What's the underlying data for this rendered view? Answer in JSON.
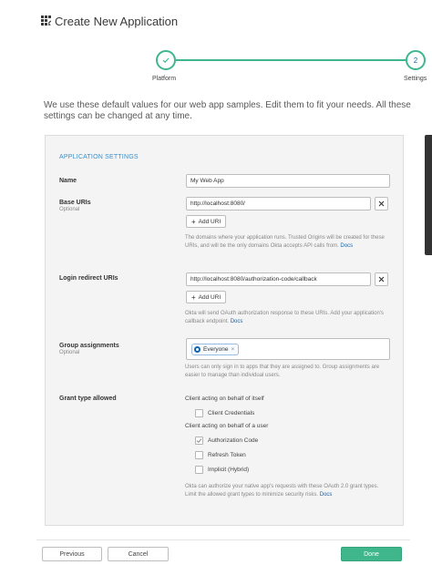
{
  "header": {
    "title": "Create New Application",
    "icon": "app-grid-icon"
  },
  "stepper": {
    "steps": [
      {
        "label": "Platform",
        "state": "complete"
      },
      {
        "label": "Settings",
        "number": "2",
        "state": "active"
      }
    ],
    "colors": {
      "accent": "#3fb68b",
      "number": "#1662a8"
    }
  },
  "intro": "We use these default values for our web app samples. Edit them to fit your needs. All these settings can be changed at any time.",
  "settings": {
    "section_title": "APPLICATION SETTINGS",
    "name": {
      "label": "Name",
      "value": "My Web App"
    },
    "base_uris": {
      "label": "Base URIs",
      "sublabel": "Optional",
      "value": "http://localhost:8080/",
      "add_label": "Add URI",
      "help": "The domains where your application runs. Trusted Origins will be created for these URIs, and will be the only domains Okta accepts API calls from.",
      "help_link": "Docs"
    },
    "login_redirect": {
      "label": "Login redirect URIs",
      "value": "http://localhost:8080/authorization-code/callback",
      "add_label": "Add URI",
      "help": "Okta will send OAuth authorization response to these URIs. Add your application's callback endpoint.",
      "help_link": "Docs"
    },
    "group_assignments": {
      "label": "Group assignments",
      "sublabel": "Optional",
      "tag": "Everyone",
      "help": "Users can only sign in to apps that they are assigned to. Group assignments are easier to manage than individual users."
    },
    "grant_type": {
      "label": "Grant type allowed",
      "itself_heading": "Client acting on behalf of itself",
      "user_heading": "Client acting on behalf of a user",
      "options": [
        {
          "label": "Client Credentials",
          "checked": false
        },
        {
          "label": "Authorization Code",
          "checked": true
        },
        {
          "label": "Refresh Token",
          "checked": false
        },
        {
          "label": "Implicit (Hybrid)",
          "checked": false
        }
      ],
      "help": "Okta can authorize your native app's requests with these OAuth 2.0 grant types. Limit the allowed grant types to minimize security risks.",
      "help_link": "Docs"
    }
  },
  "footer": {
    "previous": "Previous",
    "cancel": "Cancel",
    "done": "Done"
  }
}
